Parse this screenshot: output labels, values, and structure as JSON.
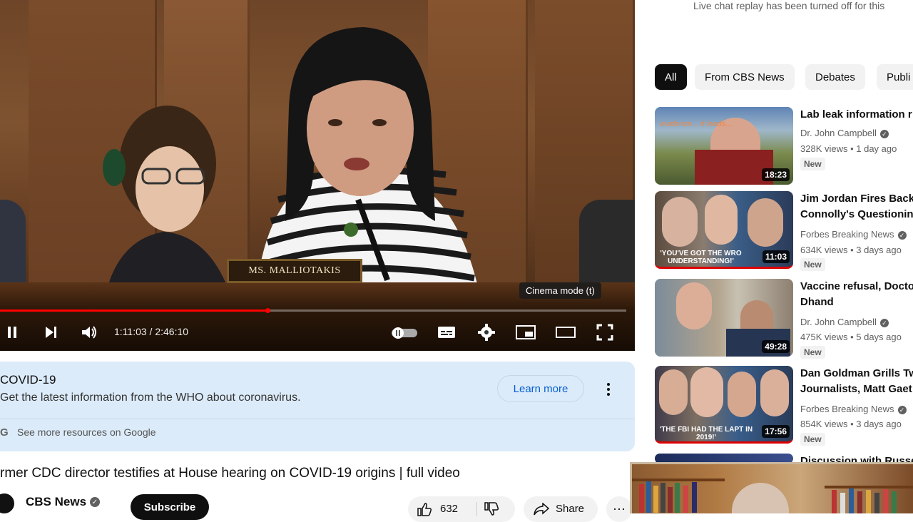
{
  "player": {
    "nameplate": "MS. MALLIOTAKIS",
    "tooltip": "Cinema mode (t)",
    "time": "1:11:03 / 2:46:10",
    "progress_fraction": 0.427,
    "icons": [
      "pause-icon",
      "next-icon",
      "volume-icon",
      "autoplay-toggle-icon",
      "subtitles-icon",
      "settings-icon",
      "miniplayer-icon",
      "theater-icon",
      "fullscreen-icon"
    ]
  },
  "info_card": {
    "title": "COVID-19",
    "subtitle": "Get the latest information from the WHO about coronavirus.",
    "learn_more": "Learn more",
    "more_resources": "See more resources on Google",
    "google_glyph": "G"
  },
  "video": {
    "title": "rmer CDC director testifies at House hearing on COVID-19 origins | full video",
    "channel": "CBS News",
    "subscribe": "Subscribe",
    "likes": "632",
    "share": "Share"
  },
  "sidebar": {
    "chat_note": "Live chat replay has been turned off for this",
    "chips": [
      "All",
      "From CBS News",
      "Debates",
      "Publi"
    ],
    "recs": [
      {
        "title1": "Lab leak information r",
        "title2": "",
        "channel": "Dr. John Campbell",
        "meta": "328K views  •  1 day ago",
        "badge": "New",
        "duration": "18:23",
        "thumb_text": "evidence...  it leads..."
      },
      {
        "title1": "Jim Jordan Fires Back",
        "title2": "Connolly's Questioning",
        "channel": "Forbes Breaking News",
        "meta": "634K views  •  3 days ago",
        "badge": "New",
        "duration": "11:03",
        "thumb_text": "'YOU'VE GOT THE WRO UNDERSTANDING!'"
      },
      {
        "title1": "Vaccine refusal, Docto",
        "title2": "Dhand",
        "channel": "Dr. John Campbell",
        "meta": "475K views  •  5 days ago",
        "badge": "New",
        "duration": "49:28",
        "thumb_text": ""
      },
      {
        "title1": "Dan Goldman Grills Tw",
        "title2": "Journalists, Matt Gaet",
        "channel": "Forbes Breaking News",
        "meta": "854K views  •  3 days ago",
        "badge": "New",
        "duration": "17:56",
        "thumb_text": "'THE FBI HAD THE LAPT IN 2019!'"
      },
      {
        "title1": "Discussion with Russe",
        "title2": "",
        "channel": "",
        "meta": "",
        "badge": "",
        "duration": "",
        "thumb_text": ""
      }
    ]
  },
  "colors": {
    "progress": "#ff0000",
    "chip_active": "#0f0f0f",
    "info_bg": "#dcebf9",
    "link": "#065fd4"
  }
}
